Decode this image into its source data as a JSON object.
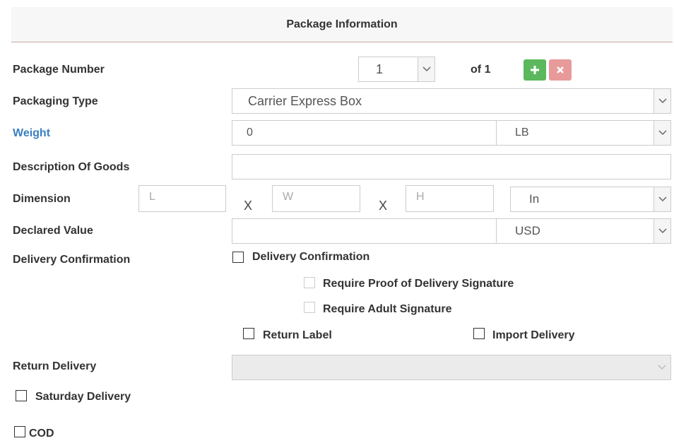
{
  "section": {
    "title": "Package Information"
  },
  "package_number": {
    "label": "Package Number",
    "value": "1",
    "of_text": "of",
    "total": "1",
    "add_icon": "plus-icon",
    "remove_icon": "close-icon"
  },
  "packaging_type": {
    "label": "Packaging Type",
    "value": "Carrier Express Box"
  },
  "weight": {
    "label": "Weight",
    "value": "0",
    "unit": "LB"
  },
  "description": {
    "label": "Description Of Goods",
    "value": ""
  },
  "dimension": {
    "label": "Dimension",
    "l_placeholder": "L",
    "w_placeholder": "W",
    "h_placeholder": "H",
    "separator": "X",
    "unit": "In"
  },
  "declared_value": {
    "label": "Declared Value",
    "value": "",
    "currency": "USD"
  },
  "delivery_confirmation": {
    "label": "Delivery Confirmation",
    "checkbox_label": "Delivery Confirmation",
    "proof_signature_label": "Require Proof of Delivery Signature",
    "adult_signature_label": "Require Adult Signature"
  },
  "return_label": {
    "label": "Return Label"
  },
  "import_delivery": {
    "label": "Import Delivery"
  },
  "return_delivery": {
    "label": "Return Delivery",
    "value": ""
  },
  "saturday_delivery": {
    "label": "Saturday Delivery"
  },
  "cod": {
    "label": "COD"
  },
  "colors": {
    "add_button": "#5cb85c",
    "remove_button": "#e89a9a",
    "link_label": "#3a7fc1"
  }
}
